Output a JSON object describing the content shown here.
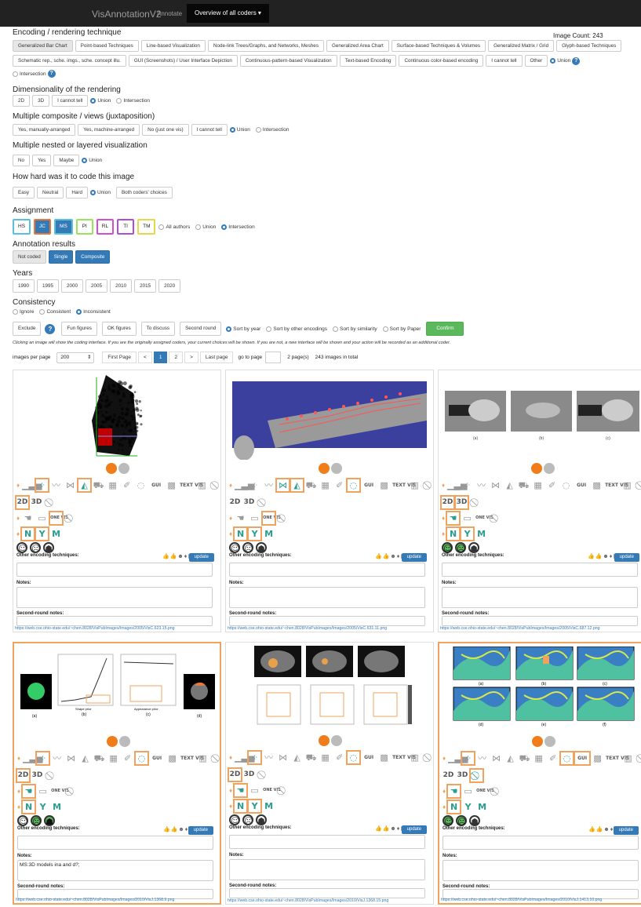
{
  "nav": {
    "brand": "VisAnnotationV2",
    "annotate": "Annotate",
    "overview": "Overview of all coders"
  },
  "image_count": "Image Count: 243",
  "encoding": {
    "heading": "Encoding / rendering technique",
    "buttons": [
      "Generalized Bar Chart",
      "Point-based Techniques",
      "Line-based Visualization",
      "Node-link Trees/Graphs, and Networks, Meshes",
      "Generalized Area Chart",
      "Surface-based Techniques & Volumes",
      "Generalized Matrix / Grid",
      "Glyph-based Techniques",
      "Schematic rep., sche. imgs., sche. concept illu.",
      "GUI (Screenshots) / User Interface Depiction",
      "Continuous-pattern-based Visualization",
      "Text-based Encoding",
      "Continuous color-based encoding",
      "I cannot tell",
      "Other"
    ],
    "union": "Union",
    "intersection": "Intersection"
  },
  "dimensionality": {
    "heading": "Dimensionality of the rendering",
    "buttons": [
      "2D",
      "3D",
      "I cannot tell"
    ],
    "union": "Union",
    "intersection": "Intersection"
  },
  "composite": {
    "heading": "Multiple composite / views (juxtaposition)",
    "buttons": [
      "Yes, manually-arranged",
      "Yes, machine-arranged",
      "No (just one vis)",
      "I cannot tell"
    ],
    "union": "Union",
    "intersection": "Intersection"
  },
  "nested": {
    "heading": "Multiple nested or layered visualization",
    "buttons": [
      "No",
      "Yes",
      "Maybe"
    ],
    "union": "Union"
  },
  "hard": {
    "heading": "How hard was it to code this image",
    "buttons": [
      "Easy",
      "Neutral",
      "Hard"
    ],
    "union": "Union",
    "both": "Both coders' choices"
  },
  "assignment": {
    "heading": "Assignment",
    "coders": [
      {
        "label": "HS",
        "color": "#5bc0de",
        "active": false
      },
      {
        "label": "JC",
        "color": "#e8773b",
        "active": true
      },
      {
        "label": "MS",
        "color": "#5bc0de",
        "active": true
      },
      {
        "label": "PI",
        "color": "#9be35b",
        "active": false
      },
      {
        "label": "RL",
        "color": "#d24fd2",
        "active": false
      },
      {
        "label": "TI",
        "color": "#b04fd2",
        "active": false
      },
      {
        "label": "TM",
        "color": "#e6d84a",
        "active": false
      }
    ],
    "all": "All authors",
    "union": "Union",
    "intersection": "Intersection"
  },
  "results": {
    "heading": "Annotation results",
    "buttons": [
      "Not coded",
      "Single",
      "Composite"
    ]
  },
  "years": {
    "heading": "Years",
    "buttons": [
      "1990",
      "1995",
      "2000",
      "2005",
      "2010",
      "2015",
      "2020"
    ]
  },
  "consistency": {
    "heading": "Consistency",
    "ignore": "Ignore",
    "consistent": "Consistent",
    "inconsistent": "Inconsistent",
    "actions": [
      "Exclude",
      "Fun figures",
      "OK figures",
      "To discuss",
      "Second round"
    ],
    "sorts": [
      "Sort by year",
      "Sort by other encodings",
      "Sort by similarity",
      "Sort by Paper"
    ],
    "confirm": "Confirm",
    "info": "Clicking an image will show the coding interface. If you are the originally assigned coders, your current choices will be shown. If you are not, a new interface will be shown and your action will be recorded as an additional coder."
  },
  "pagination": {
    "per_page_label": "images per page",
    "per_page": "200",
    "first": "First Page",
    "prev": "<",
    "p1": "1",
    "p2": "2",
    "next": ">",
    "last": "Last page",
    "goto": "go to page",
    "pages": "2 page(s)",
    "total": "243 images in total"
  },
  "card_labels": {
    "other": "Other encoding techniques:",
    "update": "update",
    "notes": "Notes:",
    "second": "Second-round notes:"
  },
  "icon_text": {
    "gui": "GUI",
    "text_vis": "TEXT VIS",
    "d2": "2D",
    "d3": "3D",
    "one_vis": "ONE VIS",
    "n": "N",
    "y": "Y",
    "m": "M"
  },
  "cards": [
    {
      "url": "https://web.cse.ohio-state.edu/~chen.8028/VisPubImages/Images/2005/VisC.623.15.png",
      "notes": ""
    },
    {
      "url": "https://web.cse.ohio-state.edu/~chen.8028/VisPubImages/Images/2005/VisC.631.11.png",
      "notes": ""
    },
    {
      "url": "https://web.cse.ohio-state.edu/~chen.8028/VisPubImages/Images/2005/VisC.687.12.png",
      "notes": ""
    },
    {
      "url": "https://web.cse.ohio-state.edu/~chen.8028/VisPubImages/Images/2010/VisJ.1368.9.png",
      "notes": "MS:3D models ina and d?;"
    },
    {
      "url": "https://web.cse.ohio-state.edu/~chen.8028/VisPubImages/Images/2010/VisJ.1368.15.png",
      "notes": ""
    },
    {
      "url": "https://web.cse.ohio-state.edu/~chen.8028/VisPubImages/Images/2010/VisJ.1413.10.png",
      "notes": ""
    }
  ],
  "thumb_text": {
    "t3": [
      "(a)",
      "(b)",
      "(c)"
    ],
    "t4": [
      "(a)",
      "(b)",
      "(c)",
      "(d)"
    ],
    "t4_axes": [
      "Shape prior",
      "Appearance prior"
    ],
    "t6": [
      "(a)",
      "(b)",
      "(c)",
      "(d)",
      "(e)",
      "(f)"
    ]
  }
}
